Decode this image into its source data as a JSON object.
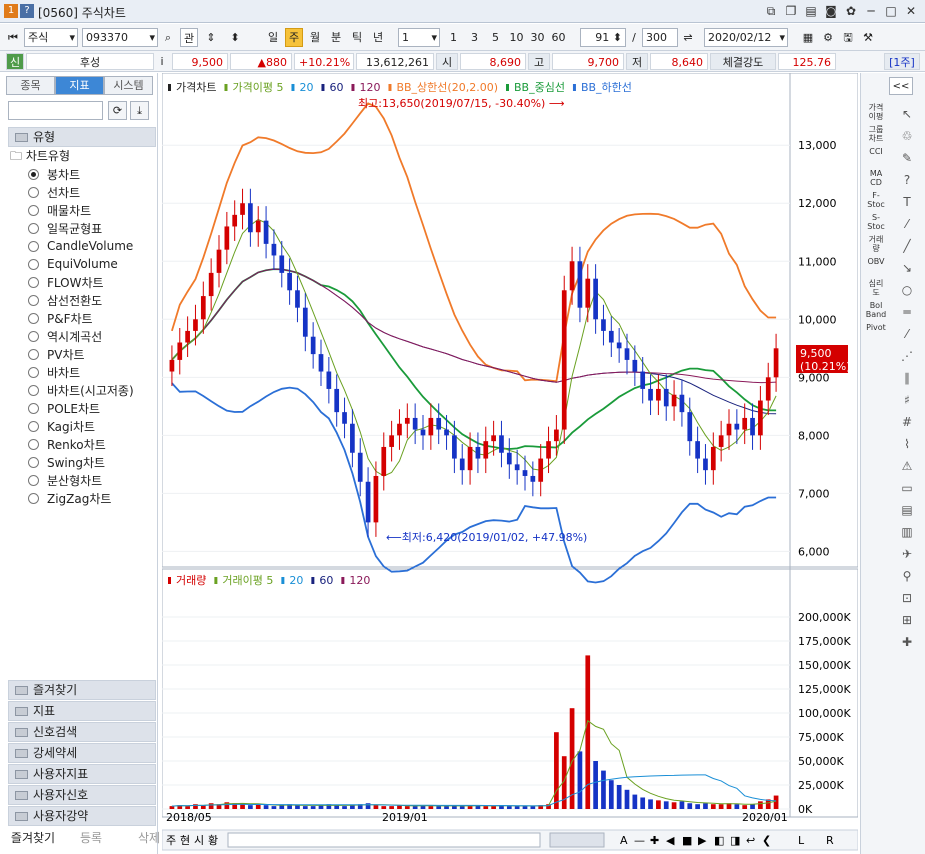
{
  "window": {
    "num": "1",
    "help": "?",
    "title": "[0560] 주식차트"
  },
  "toolbar": {
    "market": "주식",
    "code": "093370",
    "search_btn": "관",
    "periods": [
      "일",
      "주",
      "월",
      "분",
      "틱",
      "년"
    ],
    "active_period": "주",
    "interval": "1",
    "quick": [
      "1",
      "3",
      "5",
      "10",
      "30",
      "60"
    ],
    "count": "91",
    "total": "300",
    "date": "2020/02/12"
  },
  "quote": {
    "name": "후성",
    "price": "9,500",
    "change": "▲880",
    "rate": "+10.21%",
    "volume": "13,612,261",
    "open_label": "시",
    "open": "8,690",
    "high_label": "고",
    "high": "9,700",
    "low_label": "저",
    "low": "8,640",
    "strength_label": "체결강도",
    "strength": "125.76",
    "period_badge": "[1주]"
  },
  "left_panel": {
    "tabs": [
      "종목",
      "지표",
      "시스템"
    ],
    "active_tab": "지표",
    "type_section": "유형",
    "tree_root": "차트유형",
    "options": [
      "봉차트",
      "선차트",
      "매물차트",
      "일목균형표",
      "CandleVolume",
      "EquiVolume",
      "FLOW차트",
      "삼선전환도",
      "P&F차트",
      "역시계곡선",
      "PV차트",
      "바차트",
      "바차트(시고저종)",
      "POLE차트",
      "Kagi차트",
      "Renko차트",
      "Swing차트",
      "분산형차트",
      "ZigZag차트"
    ],
    "selected_option": "봉차트",
    "sections": [
      "즐겨찾기",
      "지표",
      "신호검색",
      "강세약세",
      "사용자지표",
      "사용자신호",
      "사용자강약"
    ],
    "bottom_tabs": [
      "즐겨찾기",
      "등록",
      "삭제"
    ]
  },
  "price_legend": [
    {
      "label": "가격차트",
      "color": "#222222"
    },
    {
      "label": "가격이평 5",
      "color": "#6aa121"
    },
    {
      "label": "20",
      "color": "#1a8fd6"
    },
    {
      "label": "60",
      "color": "#1a237e"
    },
    {
      "label": "120",
      "color": "#8b1a5a"
    },
    {
      "label": "BB_상한선(20,2.00)",
      "color": "#f07a2a"
    },
    {
      "label": "BB_중심선",
      "color": "#1a9b3a"
    },
    {
      "label": "BB_하한선",
      "color": "#2b6fd6"
    }
  ],
  "volume_legend": [
    {
      "label": "거래량",
      "color": "#d40000"
    },
    {
      "label": "거래이평 5",
      "color": "#6aa121"
    },
    {
      "label": "20",
      "color": "#1a8fd6"
    },
    {
      "label": "60",
      "color": "#1a237e"
    },
    {
      "label": "120",
      "color": "#8b1a5a"
    }
  ],
  "annotations": {
    "high": "최고:13,650(2019/07/15, -30.40%)",
    "low": "최저:6,420(2019/01/02, +47.98%)",
    "current_price": "9,500",
    "current_rate": "(10.21%)"
  },
  "chart_data": {
    "type": "candlestick",
    "price_axis": {
      "ticks": [
        "13,000",
        "12,000",
        "11,000",
        "10,000",
        "9,000",
        "8,000",
        "7,000",
        "6,000"
      ],
      "ylim": [
        5800,
        13900
      ]
    },
    "volume_axis": {
      "ticks": [
        "200,000K",
        "175,000K",
        "150,000K",
        "125,000K",
        "100,000K",
        "75,000K",
        "50,000K",
        "25,000K",
        "0K"
      ]
    },
    "x_labels": [
      "2018/05",
      "2019/01",
      "2020/01"
    ],
    "closes": [
      9300,
      9600,
      9800,
      10000,
      10400,
      10800,
      11200,
      11600,
      11800,
      12000,
      11500,
      11700,
      11300,
      11100,
      10800,
      10500,
      10200,
      9700,
      9400,
      9100,
      8800,
      8400,
      8200,
      7700,
      7200,
      6500,
      7300,
      7800,
      8000,
      8200,
      8300,
      8100,
      8000,
      8300,
      8100,
      8000,
      7600,
      7400,
      7800,
      7600,
      7900,
      8000,
      7700,
      7500,
      7400,
      7300,
      7200,
      7600,
      7900,
      8100,
      10500,
      11000,
      10200,
      10700,
      10000,
      9800,
      9600,
      9500,
      9300,
      9100,
      8800,
      8600,
      8800,
      8500,
      8700,
      8400,
      7900,
      7600,
      7400,
      7800,
      8000,
      8200,
      8100,
      8300,
      8000,
      8600,
      9000,
      9500
    ],
    "volume": [
      3,
      4,
      3,
      5,
      4,
      6,
      5,
      7,
      6,
      5,
      4,
      5,
      4,
      3,
      4,
      5,
      4,
      3,
      3,
      4,
      5,
      4,
      3,
      4,
      5,
      6,
      4,
      3,
      3,
      4,
      3,
      3,
      4,
      3,
      3,
      3,
      4,
      3,
      3,
      4,
      3,
      3,
      4,
      3,
      3,
      3,
      3,
      4,
      5,
      80,
      55,
      105,
      60,
      160,
      50,
      40,
      30,
      25,
      20,
      15,
      12,
      10,
      9,
      8,
      7,
      8,
      6,
      5,
      6,
      5,
      5,
      6,
      5,
      4,
      5,
      8,
      10,
      14
    ]
  },
  "status": {
    "zoom_label": "A",
    "nav_L": "L",
    "nav_R": "R"
  },
  "right_panel": {
    "labels": [
      "가격\n이평",
      "그룹\n차트",
      "CCI",
      "MA\nCD",
      "F-\nStoc",
      "S-\nStoc",
      "거래\n량",
      "OBV",
      "심리\n도",
      "Bol\nBand",
      "Pivot"
    ]
  }
}
